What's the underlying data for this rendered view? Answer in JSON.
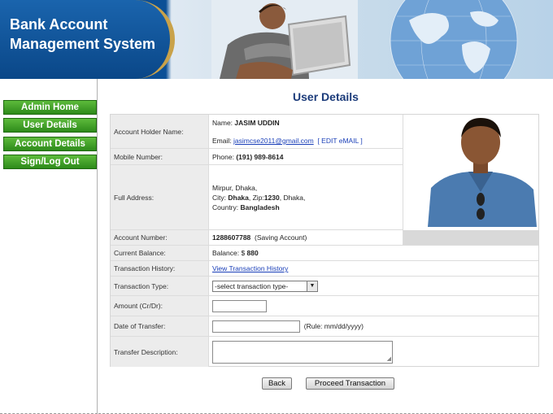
{
  "header": {
    "title_line1": "Bank Account",
    "title_line2": "Management System"
  },
  "nav": {
    "items": [
      {
        "label": "Admin Home"
      },
      {
        "label": "User Details"
      },
      {
        "label": "Account Details"
      },
      {
        "label": "Sign/Log Out"
      }
    ]
  },
  "page": {
    "title": "User Details"
  },
  "details": {
    "holder_label": "Account Holder Name:",
    "name_prefix": "Name:",
    "name_value": "JASIM UDDIN",
    "email_prefix": "Email:",
    "email_value": "jasimcse2011@gmail.com",
    "edit_email": "[ EDIT eMAIL ]",
    "mobile_label": "Mobile Number:",
    "phone_prefix": "Phone:",
    "phone_value": "(191) 989-8614",
    "address_label": "Full Address:",
    "address_line1": "Mirpur, Dhaka,",
    "city_prefix": "City:",
    "city_value": "Dhaka",
    "zip_prefix": ", Zip:",
    "zip_value": "1230",
    "city_suffix": ", Dhaka,",
    "country_prefix": "Country:",
    "country_value": "Bangladesh",
    "account_label": "Account Number:",
    "account_value": "1288607788",
    "account_type": "(Saving Account)",
    "balance_label": "Current Balance:",
    "balance_prefix": "Balance: $",
    "balance_value": "880",
    "history_label": "Transaction History:",
    "history_link": "View Transaction History",
    "type_label": "Transaction Type:",
    "type_selected": "-select transaction type-",
    "amount_label": "Amount (Cr/Dr):",
    "amount_value": "",
    "date_label": "Date of Transfer:",
    "date_value": "",
    "date_rule": "(Rule: mm/dd/yyyy)",
    "desc_label": "Transfer Description:",
    "desc_value": ""
  },
  "actions": {
    "back": "Back",
    "proceed": "Proceed Transaction"
  },
  "icons": {
    "select_arrow": "chevron-down-icon",
    "resize_grip": "resize-grip-icon"
  }
}
